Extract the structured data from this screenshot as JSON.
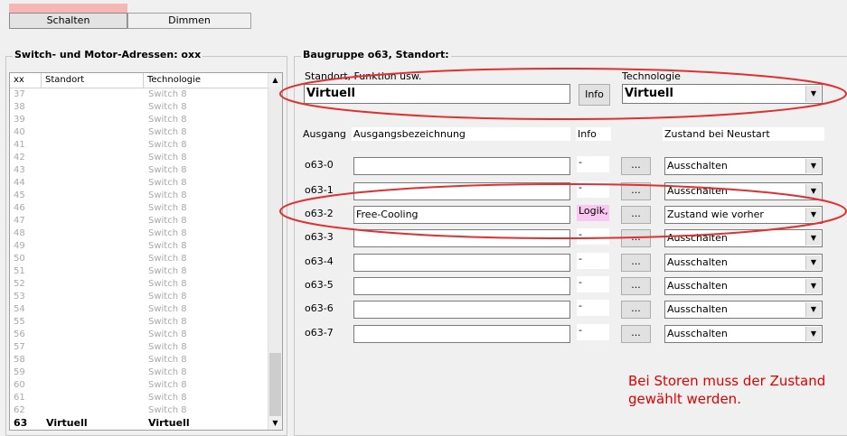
{
  "tabs": [
    {
      "label": "Schalten",
      "active": true
    },
    {
      "label": "Dimmen",
      "active": false
    }
  ],
  "left_panel": {
    "title": "Switch- und Motor-Adressen: oxx",
    "columns": [
      "xx",
      "Standort",
      "Technologie"
    ],
    "rows": [
      {
        "xx": "37",
        "standort": "",
        "tech": "Switch 8"
      },
      {
        "xx": "38",
        "standort": "",
        "tech": "Switch 8"
      },
      {
        "xx": "39",
        "standort": "",
        "tech": "Switch 8"
      },
      {
        "xx": "40",
        "standort": "",
        "tech": "Switch 8"
      },
      {
        "xx": "41",
        "standort": "",
        "tech": "Switch 8"
      },
      {
        "xx": "42",
        "standort": "",
        "tech": "Switch 8"
      },
      {
        "xx": "43",
        "standort": "",
        "tech": "Switch 8"
      },
      {
        "xx": "44",
        "standort": "",
        "tech": "Switch 8"
      },
      {
        "xx": "45",
        "standort": "",
        "tech": "Switch 8"
      },
      {
        "xx": "46",
        "standort": "",
        "tech": "Switch 8"
      },
      {
        "xx": "47",
        "standort": "",
        "tech": "Switch 8"
      },
      {
        "xx": "48",
        "standort": "",
        "tech": "Switch 8"
      },
      {
        "xx": "49",
        "standort": "",
        "tech": "Switch 8"
      },
      {
        "xx": "50",
        "standort": "",
        "tech": "Switch 8"
      },
      {
        "xx": "51",
        "standort": "",
        "tech": "Switch 8"
      },
      {
        "xx": "52",
        "standort": "",
        "tech": "Switch 8"
      },
      {
        "xx": "53",
        "standort": "",
        "tech": "Switch 8"
      },
      {
        "xx": "54",
        "standort": "",
        "tech": "Switch 8"
      },
      {
        "xx": "55",
        "standort": "",
        "tech": "Switch 8"
      },
      {
        "xx": "56",
        "standort": "",
        "tech": "Switch 8"
      },
      {
        "xx": "57",
        "standort": "",
        "tech": "Switch 8"
      },
      {
        "xx": "58",
        "standort": "",
        "tech": "Switch 8"
      },
      {
        "xx": "59",
        "standort": "",
        "tech": "Switch 8"
      },
      {
        "xx": "60",
        "standort": "",
        "tech": "Switch 8"
      },
      {
        "xx": "61",
        "standort": "",
        "tech": "Switch 8"
      },
      {
        "xx": "62",
        "standort": "",
        "tech": "Switch 8"
      },
      {
        "xx": "63",
        "standort": "Virtuell",
        "tech": "Virtuell",
        "selected": true
      }
    ]
  },
  "right_panel": {
    "title": "Baugruppe o63, Standort:",
    "standort_label": "Standort, Funktion usw.",
    "standort_value": "Virtuell",
    "info_button": "Info",
    "tech_label": "Technologie",
    "tech_value": "Virtuell",
    "headers": {
      "ausgang": "Ausgang",
      "bezeichnung": "Ausgangsbezeichnung",
      "info": "Info",
      "zustand": "Zustand bei Neustart"
    },
    "outputs": [
      {
        "name": "o63-0",
        "bezeichnung": "",
        "info": "-",
        "zustand": "Ausschalten"
      },
      {
        "name": "o63-1",
        "bezeichnung": "",
        "info": "-",
        "zustand": "Ausschalten"
      },
      {
        "name": "o63-2",
        "bezeichnung": "Free-Cooling",
        "info": "Logik, F",
        "zustand": "Zustand wie vorher",
        "highlight": true
      },
      {
        "name": "o63-3",
        "bezeichnung": "",
        "info": "-",
        "zustand": "Ausschalten"
      },
      {
        "name": "o63-4",
        "bezeichnung": "",
        "info": "-",
        "zustand": "Ausschalten"
      },
      {
        "name": "o63-5",
        "bezeichnung": "",
        "info": "-",
        "zustand": "Ausschalten"
      },
      {
        "name": "o63-6",
        "bezeichnung": "",
        "info": "-",
        "zustand": "Ausschalten"
      },
      {
        "name": "o63-7",
        "bezeichnung": "",
        "info": "-",
        "zustand": "Ausschalten"
      }
    ],
    "dots_label": "...",
    "note_line1": "Bei Storen muss der Zustand",
    "note_line2": "gewählt werden."
  },
  "colors": {
    "annotation": "#e03030",
    "note_text": "#e00000",
    "info_highlight": "#f8c8f0",
    "tab_accent": "#f6b6b6"
  }
}
